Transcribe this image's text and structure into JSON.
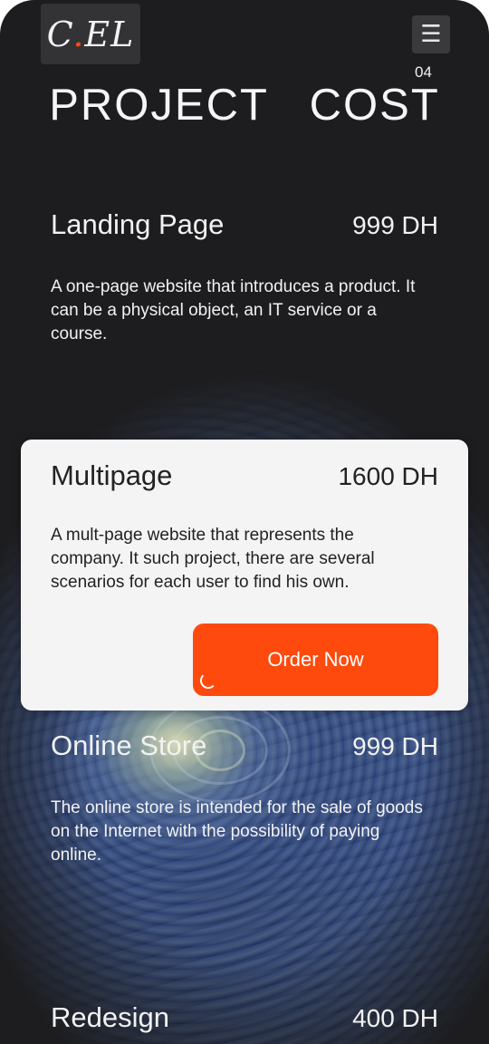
{
  "header": {
    "logo_text": "C",
    "logo_dot": ".",
    "logo_text_end": "EL",
    "menu_icon": "hamburger-icon",
    "menu_glyph": "☰",
    "section_number": "04"
  },
  "page_title": "PROJECT COST",
  "plans": [
    {
      "name": "Landing Page",
      "price": "999 DH",
      "description": "A one-page website that introduces a product. It can be a physical object, an IT service or a course."
    },
    {
      "name": "Multipage",
      "price": "1600 DH",
      "description": "A mult-page website that represents the company. It such project, there are several scenarios for each user to find his own.",
      "button_label": "Order Now"
    },
    {
      "name": "Online Store",
      "price": "999 DH",
      "description": "The online store is intended for the sale of goods on the Internet with the possibility of paying online."
    },
    {
      "name": "Redesign",
      "price": "400 DH"
    }
  ],
  "colors": {
    "background": "#1d1d1f",
    "accent": "#ff4a0d",
    "card": "#f4f4f4"
  }
}
